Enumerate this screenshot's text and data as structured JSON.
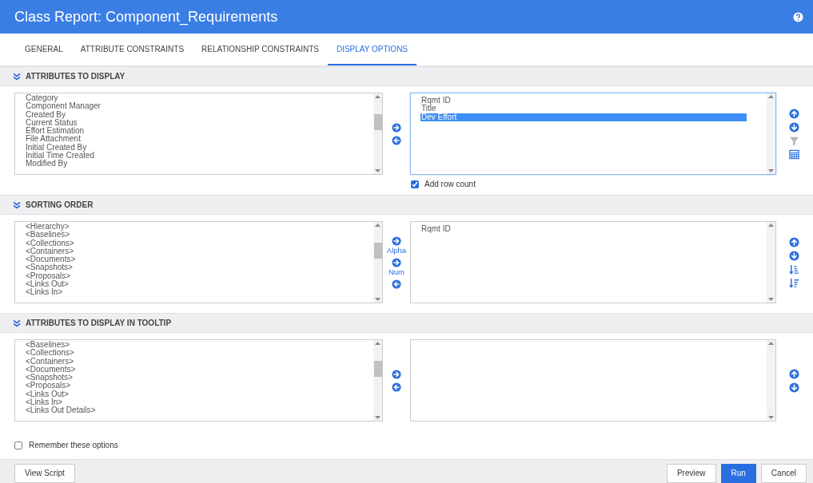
{
  "window": {
    "title": "Class Report: Component_Requirements"
  },
  "tabs": [
    {
      "label": "GENERAL",
      "selected": false
    },
    {
      "label": "ATTRIBUTE CONSTRAINTS",
      "selected": false
    },
    {
      "label": "RELATIONSHIP CONSTRAINTS",
      "selected": false
    },
    {
      "label": "DISPLAY OPTIONS",
      "selected": true
    }
  ],
  "sections": [
    {
      "title": "ATTRIBUTES TO DISPLAY",
      "available": [
        "Category",
        "Component Manager",
        "Created By",
        "Current Status",
        "Effort Estimation",
        "File Attachment",
        "Initial Created By",
        "Initial Time Created",
        "Modified By"
      ],
      "chosen": [
        {
          "label": "Rqmt ID",
          "selected": false
        },
        {
          "label": "Title",
          "selected": false
        },
        {
          "label": "Dev Effort",
          "selected": true
        }
      ],
      "transfer_buttons": [
        {
          "kind": "add"
        },
        {
          "kind": "remove"
        }
      ],
      "order_buttons": [
        {
          "kind": "up",
          "disabled": false
        },
        {
          "kind": "down",
          "disabled": false
        },
        {
          "kind": "filter",
          "disabled": true
        },
        {
          "kind": "table",
          "disabled": false
        }
      ],
      "option": {
        "label": "Add row count",
        "checked": true
      }
    },
    {
      "title": "SORTING ORDER",
      "available": [
        "<Hierarchy>",
        "<Baselines>",
        "<Collections>",
        "<Containers>",
        "<Documents>",
        "<Snapshots>",
        "<Proposals>",
        "<Links Out>",
        "<Links In>"
      ],
      "chosen": [
        {
          "label": "Rqmt ID",
          "selected": false
        }
      ],
      "transfer_buttons": [
        {
          "kind": "add",
          "label": "Alpha"
        },
        {
          "kind": "add",
          "label": "Num"
        },
        {
          "kind": "remove"
        }
      ],
      "order_buttons": [
        {
          "kind": "up",
          "disabled": false
        },
        {
          "kind": "down",
          "disabled": false
        },
        {
          "kind": "sort-asc",
          "disabled": false
        },
        {
          "kind": "sort-desc",
          "disabled": false
        }
      ]
    },
    {
      "title": "ATTRIBUTES TO DISPLAY IN TOOLTIP",
      "available": [
        "<Baselines>",
        "<Collections>",
        "<Containers>",
        "<Documents>",
        "<Snapshots>",
        "<Proposals>",
        "<Links Out>",
        "<Links In>",
        "<Links Out Details>"
      ],
      "transfer_buttons": [
        {
          "kind": "add"
        },
        {
          "kind": "remove"
        }
      ],
      "order_buttons": [
        {
          "kind": "up",
          "disabled": false
        },
        {
          "kind": "down",
          "disabled": false
        }
      ]
    }
  ],
  "remember": {
    "label": "Remember these options",
    "checked": false
  },
  "footer": {
    "left_buttons": [
      {
        "label": "View Script",
        "primary": false
      }
    ],
    "right_buttons": [
      {
        "label": "Preview",
        "primary": false
      },
      {
        "label": "Run",
        "primary": true
      },
      {
        "label": "Cancel",
        "primary": false
      }
    ]
  }
}
